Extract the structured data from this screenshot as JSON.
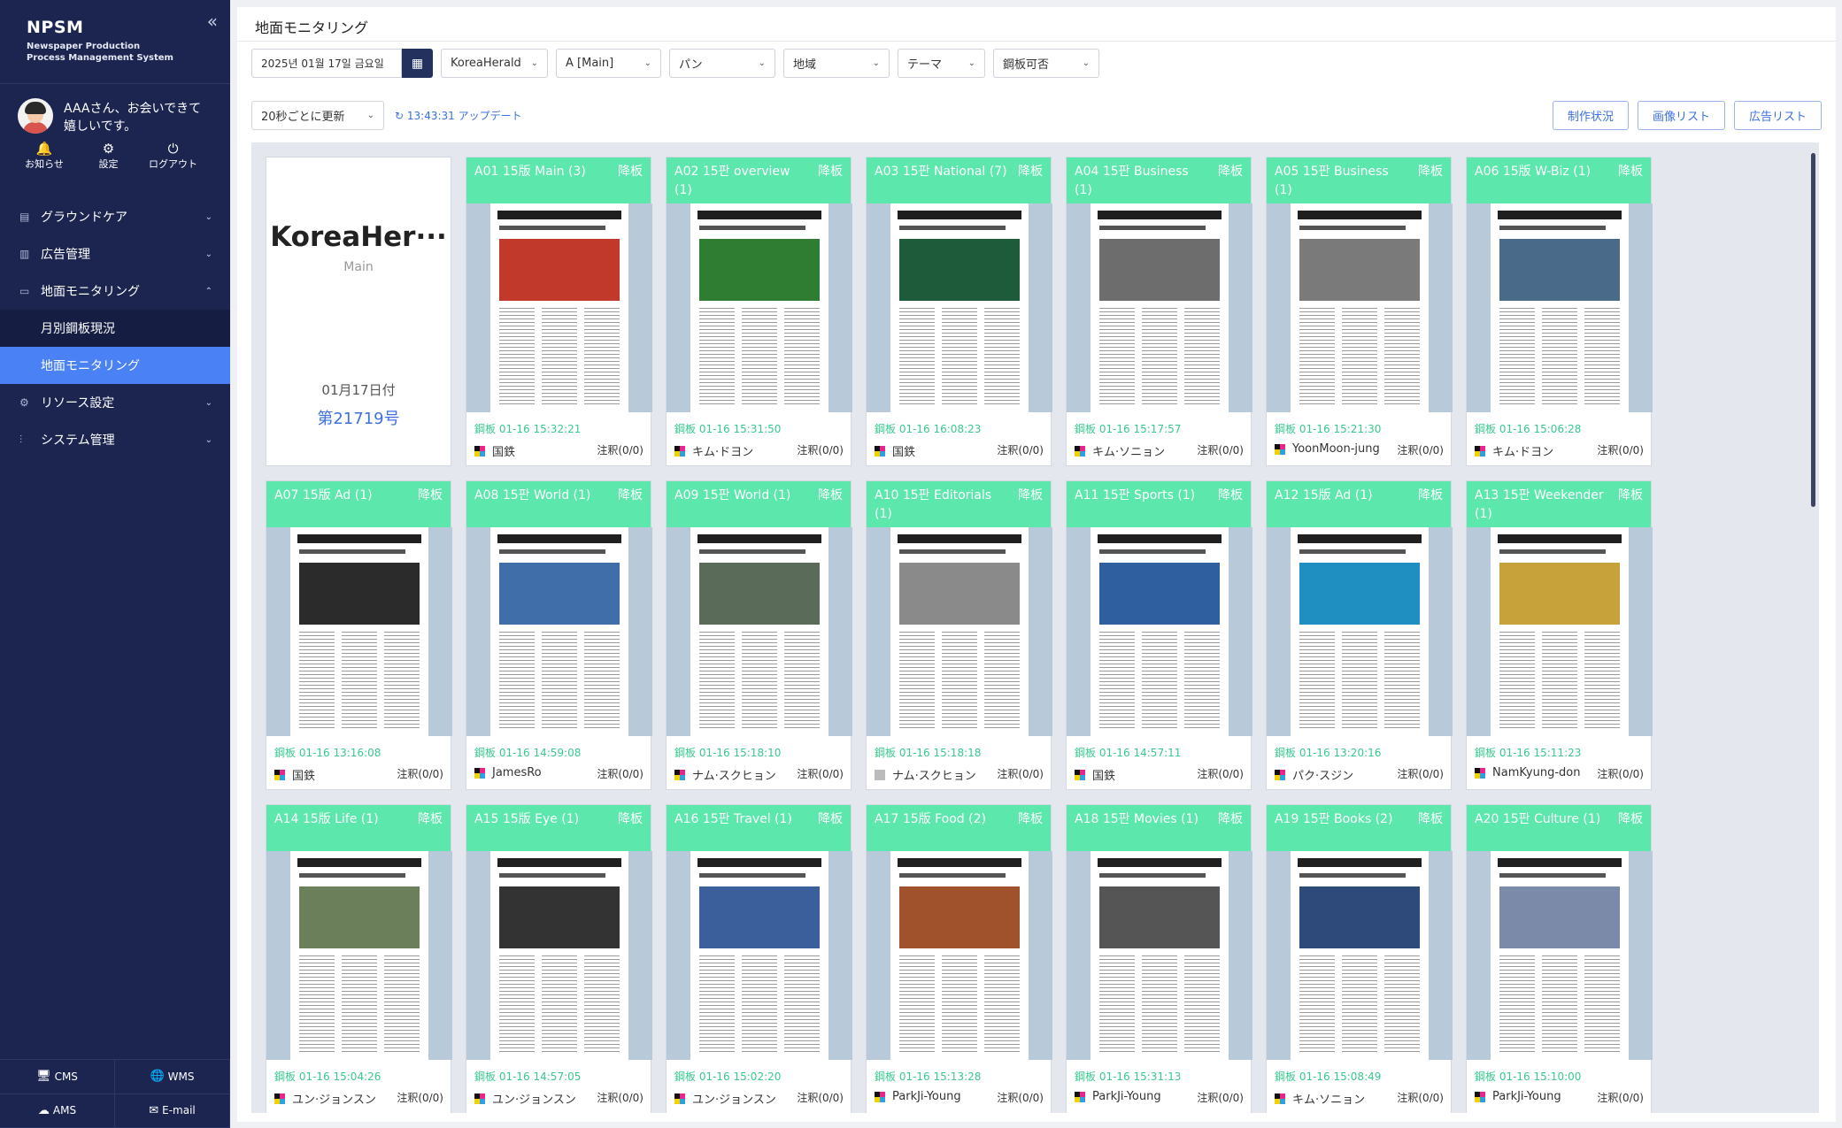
{
  "app": {
    "brand": "NPSM",
    "brand_sub_1": "Newspaper Production",
    "brand_sub_2": "Process Management System",
    "collapse_icon": "«"
  },
  "user": {
    "greeting": "AAAさん、お会いできて嬉しいです。",
    "actions": [
      {
        "icon": "bell-icon",
        "label": "お知らせ"
      },
      {
        "icon": "gear-icon",
        "label": "設定"
      },
      {
        "icon": "power-icon",
        "label": "ログアウト"
      }
    ]
  },
  "nav": {
    "items": [
      {
        "label": "グラウンドケア",
        "icon": "grid-icon",
        "chevron": "⌄"
      },
      {
        "label": "広告管理",
        "icon": "chart-icon",
        "chevron": "⌄"
      },
      {
        "label": "地面モニタリング",
        "icon": "monitor-icon",
        "chevron": "⌃"
      }
    ],
    "subitems": [
      {
        "label": "月別鋼板現況",
        "active": false
      },
      {
        "label": "地面モニタリング",
        "active": true
      }
    ],
    "items_after": [
      {
        "label": "リソース設定",
        "icon": "gear-icon",
        "chevron": "⌄"
      },
      {
        "label": "システム管理",
        "icon": "sliders-icon",
        "chevron": "⌄"
      }
    ]
  },
  "bottom_links": [
    {
      "icon": "monitor-icon",
      "label": "CMS"
    },
    {
      "icon": "globe-icon",
      "label": "WMS"
    },
    {
      "icon": "cloud-icon",
      "label": "AMS"
    },
    {
      "icon": "mail-icon",
      "label": "E-mail"
    }
  ],
  "page": {
    "title": "地面モニタリング"
  },
  "filters": {
    "date": "2025년 01월 17일 금요일",
    "selects": [
      {
        "value": "KoreaHerald"
      },
      {
        "value": "A [Main]"
      },
      {
        "value": "パン"
      },
      {
        "value": "地域"
      },
      {
        "value": "テーマ"
      },
      {
        "value": "鋼板可否"
      }
    ],
    "refresh": "20秒ごとに更新",
    "update": "13:43:31 アップデート"
  },
  "buttons": {
    "status": "制作状況",
    "image_list": "画像リスト",
    "ad_list": "広告リスト"
  },
  "cover": {
    "name": "KoreaHer···",
    "section": "Main",
    "date": "01月17日付",
    "issue": "第21719号"
  },
  "pages": [
    {
      "title": "A01 15版 Main (3)",
      "badge": "降板",
      "time": "鋼板 01-16 15:32:21",
      "user": "国鉄",
      "note": "注釈(0/0)",
      "tone": "#c0392b",
      "gray": false
    },
    {
      "title": "A02 15판 overview (1)",
      "badge": "降板",
      "time": "鋼板 01-16 15:31:50",
      "user": "キム·ドヨン",
      "note": "注釈(0/0)",
      "tone": "#2e7d32",
      "gray": false
    },
    {
      "title": "A03 15판 National (7)",
      "badge": "降板",
      "time": "鋼板 01-16 16:08:23",
      "user": "国鉄",
      "note": "注釈(0/0)",
      "tone": "#1e5b3a",
      "gray": false
    },
    {
      "title": "A04 15판 Business (1)",
      "badge": "降板",
      "time": "鋼板 01-16 15:17:57",
      "user": "キム·ソニョン",
      "note": "注釈(0/0)",
      "tone": "#6d6d6d",
      "gray": false
    },
    {
      "title": "A05 15판 Business (1)",
      "badge": "降板",
      "time": "鋼板 01-16 15:21:30",
      "user": "YoonMoon-jung",
      "note": "注釈(0/0)",
      "tone": "#7a7a7a",
      "gray": false
    },
    {
      "title": "A06 15版 W-Biz (1)",
      "badge": "降板",
      "time": "鋼板 01-16 15:06:28",
      "user": "キム·ドヨン",
      "note": "注釈(0/0)",
      "tone": "#4a6a8a",
      "gray": false
    },
    {
      "title": "A07 15版 Ad (1)",
      "badge": "降板",
      "time": "鋼板 01-16 13:16:08",
      "user": "国鉄",
      "note": "注釈(0/0)",
      "tone": "#2b2b2b",
      "gray": false
    },
    {
      "title": "A08 15판 World (1)",
      "badge": "降板",
      "time": "鋼板 01-16 14:59:08",
      "user": "JamesRo",
      "note": "注釈(0/0)",
      "tone": "#3f6ea8",
      "gray": false
    },
    {
      "title": "A09 15판 World (1)",
      "badge": "降板",
      "time": "鋼板 01-16 15:18:10",
      "user": "ナム·スクヒョン",
      "note": "注釈(0/0)",
      "tone": "#5a6b5a",
      "gray": false
    },
    {
      "title": "A10 15판 Editorials (1)",
      "badge": "降板",
      "time": "鋼板 01-16 15:18:18",
      "user": "ナム·スクヒョン",
      "note": "注釈(0/0)",
      "tone": "#8a8a8a",
      "gray": true
    },
    {
      "title": "A11 15판 Sports (1)",
      "badge": "降板",
      "time": "鋼板 01-16 14:57:11",
      "user": "国鉄",
      "note": "注釈(0/0)",
      "tone": "#2f5f9f",
      "gray": false
    },
    {
      "title": "A12 15版 Ad (1)",
      "badge": "降板",
      "time": "鋼板 01-16 13:20:16",
      "user": "パク·スジン",
      "note": "注釈(0/0)",
      "tone": "#1f8fc2",
      "gray": false
    },
    {
      "title": "A13 15판 Weekender (1)",
      "badge": "降板",
      "time": "鋼板 01-16 15:11:23",
      "user": "NamKyung-don",
      "note": "注釈(0/0)",
      "tone": "#c7a23a",
      "gray": false
    },
    {
      "title": "A14 15版 Life (1)",
      "badge": "降板",
      "time": "鋼板 01-16 15:04:26",
      "user": "ユン·ジョンスン",
      "note": "注釈(0/0)",
      "tone": "#6b7f5a",
      "gray": false
    },
    {
      "title": "A15 15版 Eye (1)",
      "badge": "降板",
      "time": "鋼板 01-16 14:57:05",
      "user": "ユン·ジョンスン",
      "note": "注釈(0/0)",
      "tone": "#333333",
      "gray": false
    },
    {
      "title": "A16 15판 Travel (1)",
      "badge": "降板",
      "time": "鋼板 01-16 15:02:20",
      "user": "ユン·ジョンスン",
      "note": "注釈(0/0)",
      "tone": "#3a5f9a",
      "gray": false
    },
    {
      "title": "A17 15版 Food (2)",
      "badge": "降板",
      "time": "鋼板 01-16 15:13:28",
      "user": "ParkJi-Young",
      "note": "注釈(0/0)",
      "tone": "#a0522d",
      "gray": false
    },
    {
      "title": "A18 15판 Movies (1)",
      "badge": "降板",
      "time": "鋼板 01-16 15:31:13",
      "user": "ParkJi-Young",
      "note": "注釈(0/0)",
      "tone": "#555555",
      "gray": false
    },
    {
      "title": "A19 15판 Books (2)",
      "badge": "降板",
      "time": "鋼板 01-16 15:08:49",
      "user": "キム·ソニョン",
      "note": "注釈(0/0)",
      "tone": "#2e4a7a",
      "gray": false
    },
    {
      "title": "A20 15판 Culture (1)",
      "badge": "降板",
      "time": "鋼板 01-16 15:10:00",
      "user": "ParkJi-Young",
      "note": "注釈(0/0)",
      "tone": "#7a8aa8",
      "gray": false
    }
  ]
}
